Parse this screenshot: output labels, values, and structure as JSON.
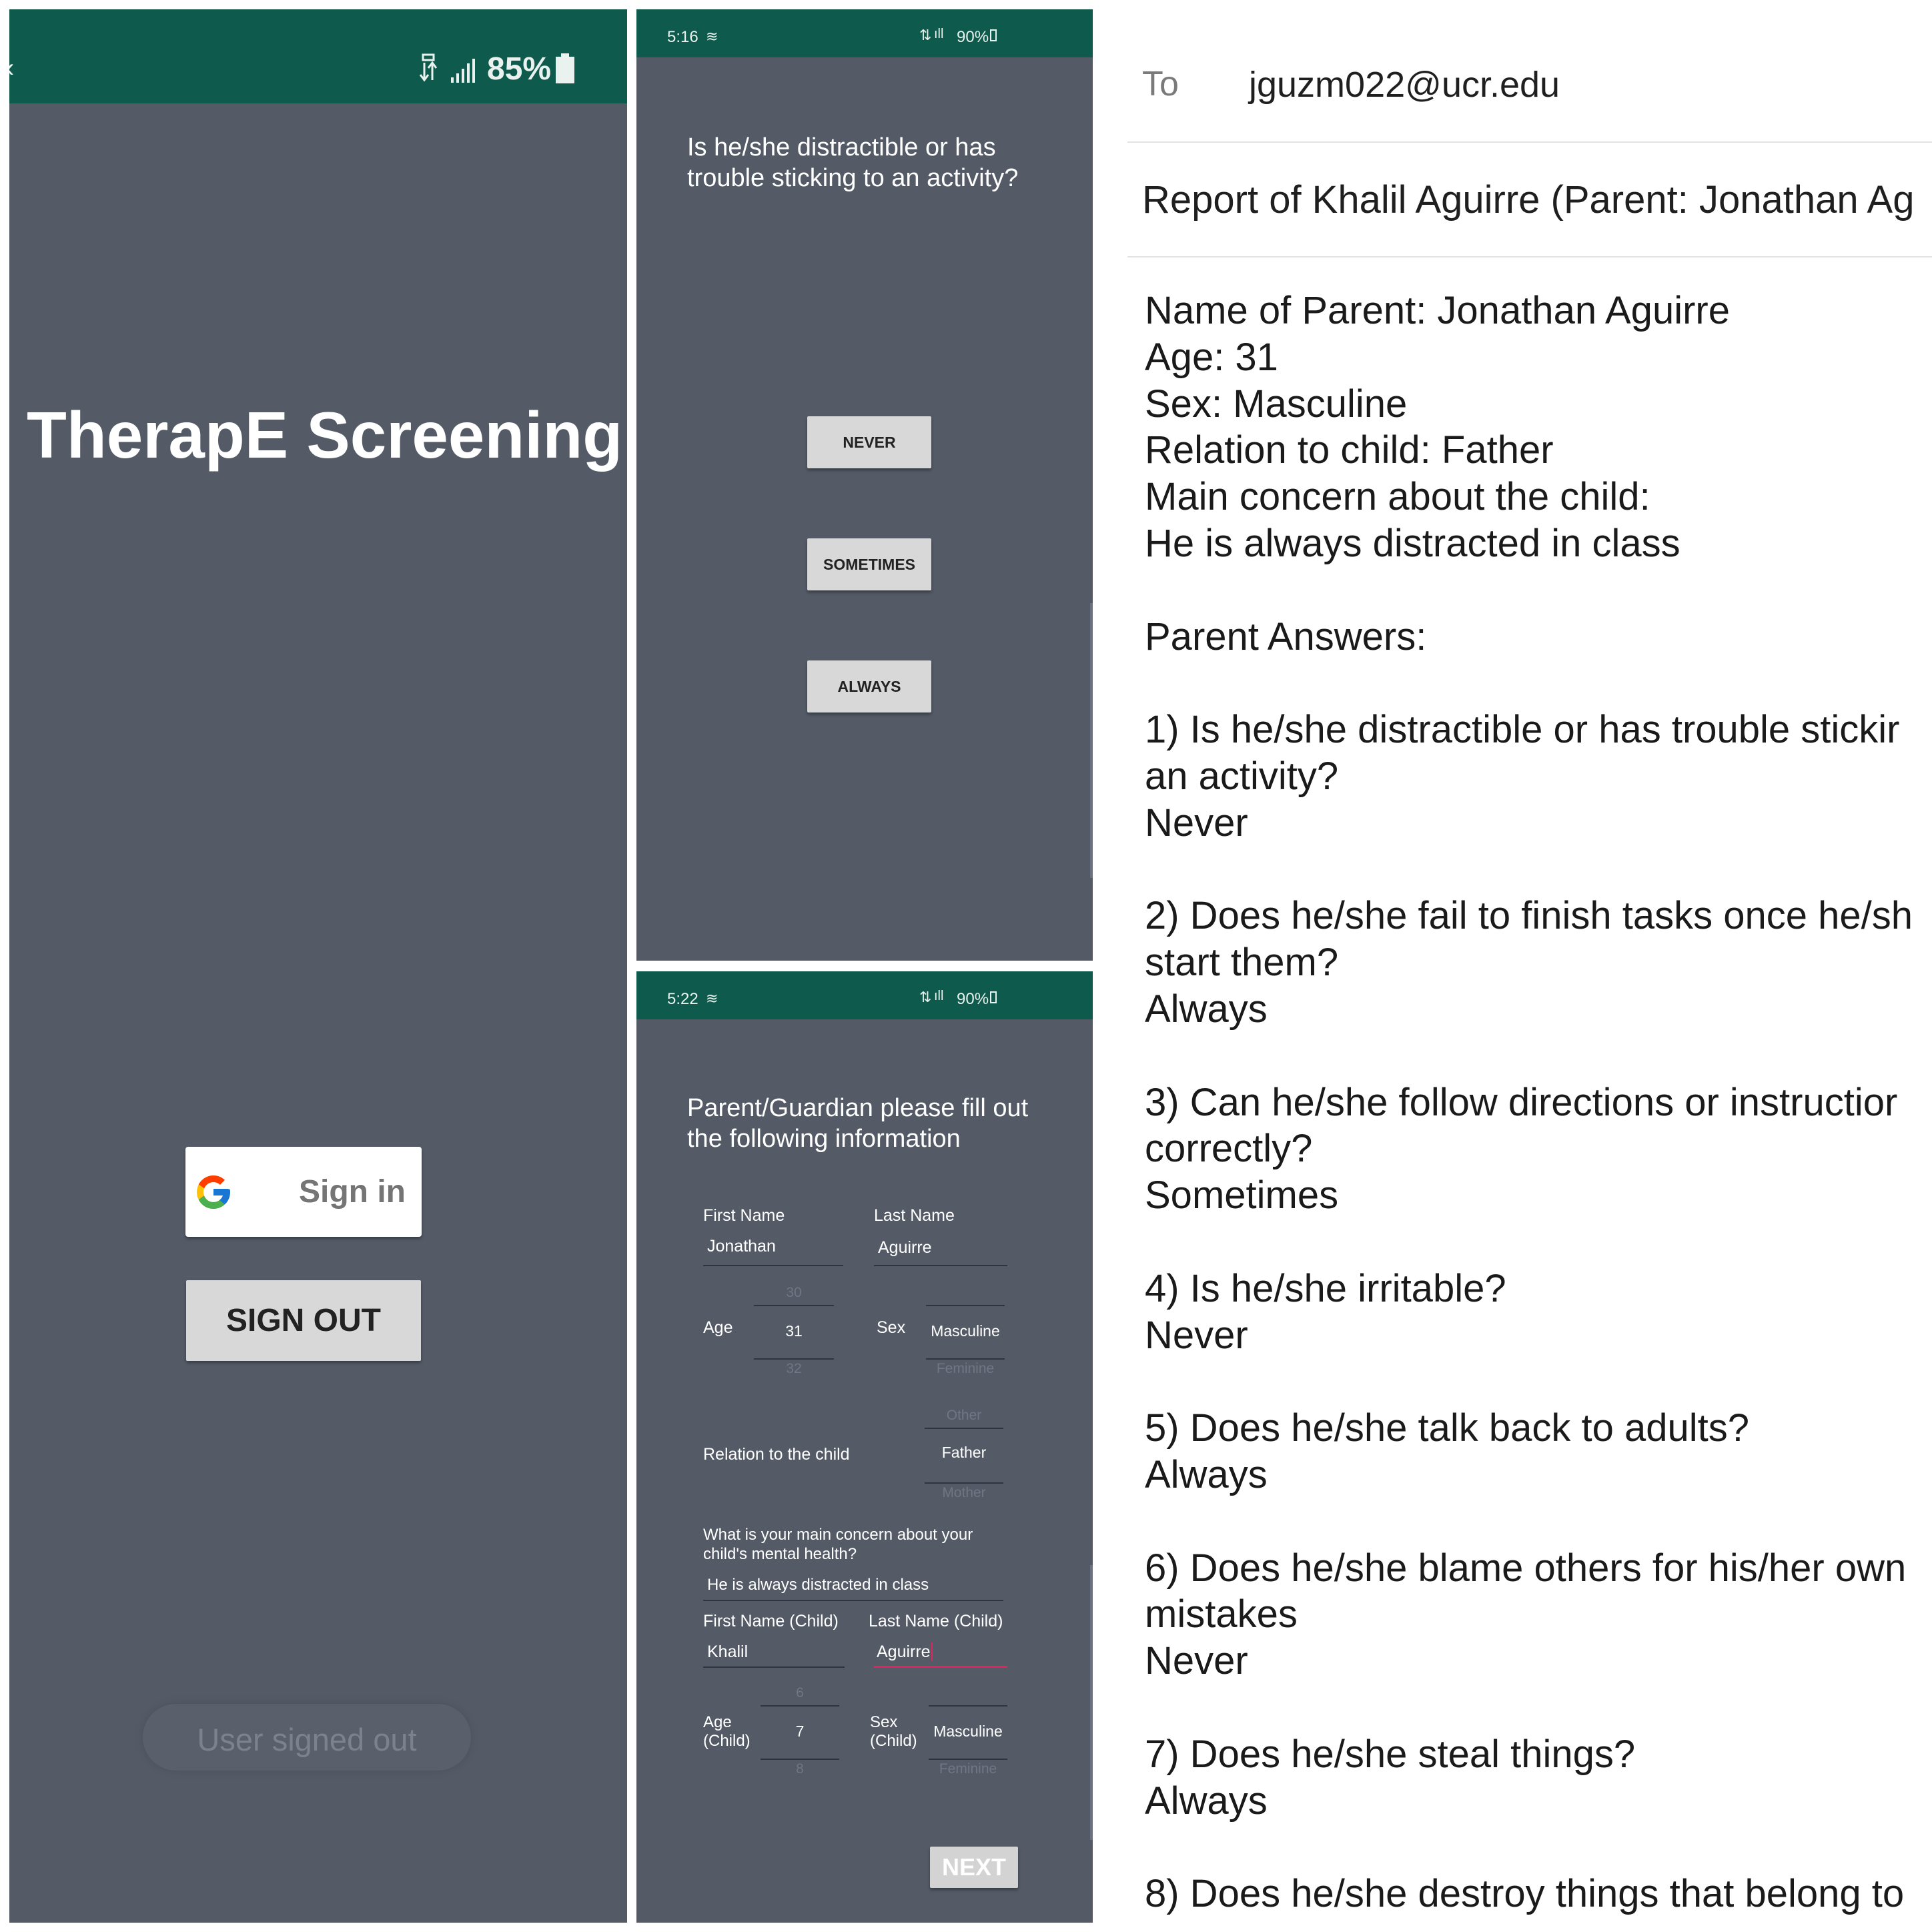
{
  "screen1": {
    "status": {
      "battery_pct": "85%"
    },
    "title": "TherapE Screening",
    "signin_label": "Sign in",
    "signout_label": "SIGN OUT",
    "toast": "User signed out",
    "colors": {
      "statusbar": "#0e5a4c",
      "background": "#545b67"
    }
  },
  "screen2": {
    "status": {
      "time": "5:16",
      "battery_pct": "90%"
    },
    "question_line1": "Is he/she distractible or has",
    "question_line2": "trouble sticking to an activity?",
    "answers": [
      "NEVER",
      "SOMETIMES",
      "ALWAYS"
    ]
  },
  "screen3": {
    "status": {
      "time": "5:22",
      "battery_pct": "90%"
    },
    "heading_line1": "Parent/Guardian please fill out",
    "heading_line2": "the following information",
    "first_name": {
      "label": "First Name",
      "value": "Jonathan"
    },
    "last_name": {
      "label": "Last Name",
      "value": "Aguirre"
    },
    "age": {
      "label": "Age",
      "prev": "30",
      "value": "31",
      "next": "32"
    },
    "sex": {
      "label": "Sex",
      "value": "Masculine",
      "next": "Feminine"
    },
    "relation": {
      "label": "Relation to the child",
      "prev": "Other",
      "value": "Father",
      "next": "Mother"
    },
    "concern": {
      "label_line1": "What is your main concern about your",
      "label_line2": "child's mental health?",
      "value": "He is always distracted in class"
    },
    "child_first": {
      "label": "First Name (Child)",
      "value": "Khalil"
    },
    "child_last": {
      "label": "Last Name (Child)",
      "value": "Aguirre"
    },
    "child_age": {
      "label_line1": "Age",
      "label_line2": "(Child)",
      "prev": "6",
      "value": "7",
      "next": "8"
    },
    "child_sex": {
      "label_line1": "Sex",
      "label_line2": "(Child)",
      "value": "Masculine",
      "next": "Feminine"
    },
    "next_label": "NEXT"
  },
  "email": {
    "to_label": "To",
    "to_address": "jguzm022@ucr.edu",
    "subject": "Report of Khalil Aguirre (Parent: Jonathan  Ag",
    "body_lines": [
      "Name of Parent: Jonathan  Aguirre",
      "Age: 31",
      "Sex: Masculine",
      "Relation to child: Father",
      "Main concern about the child:",
      "He is always distracted in class",
      "",
      "Parent Answers:",
      "",
      "1) Is he/she distractible or has trouble stickir",
      "an activity?",
      "Never",
      "",
      "2) Does he/she fail to finish tasks once he/sh",
      "start them?",
      "Always",
      "",
      "3) Can he/she follow directions or instructior",
      "correctly?",
      "Sometimes",
      "",
      "4) Is he/she irritable?",
      "Never",
      "",
      "5) Does he/she talk back to adults?",
      "Always",
      "",
      "6) Does he/she blame others for his/her own",
      "mistakes",
      "Never",
      "",
      "7) Does he/she steal things?",
      "Always",
      "",
      "8) Does he/she destroy things that belong to"
    ]
  }
}
